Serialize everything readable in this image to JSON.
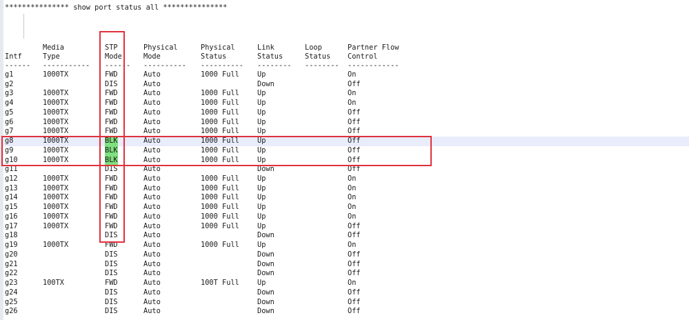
{
  "title_line": "*************** show port status all ***************",
  "columns": [
    {
      "key": "intf",
      "line1": "",
      "line2": "Intf",
      "dash": "------"
    },
    {
      "key": "media",
      "line1": "Media",
      "line2": "Type",
      "dash": "-----------"
    },
    {
      "key": "stp",
      "line1": "STP",
      "line2": "Mode",
      "dash": "------"
    },
    {
      "key": "phys_mode",
      "line1": "Physical",
      "line2": "Mode",
      "dash": "----------"
    },
    {
      "key": "phys_status",
      "line1": "Physical",
      "line2": "Status",
      "dash": "----------"
    },
    {
      "key": "link",
      "line1": "Link",
      "line2": "Status",
      "dash": "--------"
    },
    {
      "key": "loop",
      "line1": "Loop",
      "line2": "Status",
      "dash": "--------"
    },
    {
      "key": "flow",
      "line1": "Partner Flow",
      "line2": "Control",
      "dash": "------------"
    }
  ],
  "rows": [
    {
      "intf": "g1",
      "media": "1000TX",
      "stp": "FWD",
      "phys_mode": "Auto",
      "phys_status": "1000 Full",
      "link": "Up",
      "loop": "",
      "flow": "On"
    },
    {
      "intf": "g2",
      "media": "",
      "stp": "DIS",
      "phys_mode": "Auto",
      "phys_status": "",
      "link": "Down",
      "loop": "",
      "flow": "Off"
    },
    {
      "intf": "g3",
      "media": "1000TX",
      "stp": "FWD",
      "phys_mode": "Auto",
      "phys_status": "1000 Full",
      "link": "Up",
      "loop": "",
      "flow": "On"
    },
    {
      "intf": "g4",
      "media": "1000TX",
      "stp": "FWD",
      "phys_mode": "Auto",
      "phys_status": "1000 Full",
      "link": "Up",
      "loop": "",
      "flow": "On"
    },
    {
      "intf": "g5",
      "media": "1000TX",
      "stp": "FWD",
      "phys_mode": "Auto",
      "phys_status": "1000 Full",
      "link": "Up",
      "loop": "",
      "flow": "Off"
    },
    {
      "intf": "g6",
      "media": "1000TX",
      "stp": "FWD",
      "phys_mode": "Auto",
      "phys_status": "1000 Full",
      "link": "Up",
      "loop": "",
      "flow": "Off"
    },
    {
      "intf": "g7",
      "media": "1000TX",
      "stp": "FWD",
      "phys_mode": "Auto",
      "phys_status": "1000 Full",
      "link": "Up",
      "loop": "",
      "flow": "Off"
    },
    {
      "intf": "g8",
      "media": "1000TX",
      "stp": "BLK",
      "phys_mode": "Auto",
      "phys_status": "1000 Full",
      "link": "Up",
      "loop": "",
      "flow": "Off",
      "highlight": true
    },
    {
      "intf": "g9",
      "media": "1000TX",
      "stp": "BLK",
      "phys_mode": "Auto",
      "phys_status": "1000 Full",
      "link": "Up",
      "loop": "",
      "flow": "Off",
      "highlight": true
    },
    {
      "intf": "g10",
      "media": "1000TX",
      "stp": "BLK",
      "phys_mode": "Auto",
      "phys_status": "1000 Full",
      "link": "Up",
      "loop": "",
      "flow": "Off",
      "highlight": true
    },
    {
      "intf": "g11",
      "media": "",
      "stp": "DIS",
      "phys_mode": "Auto",
      "phys_status": "",
      "link": "Down",
      "loop": "",
      "flow": "Off"
    },
    {
      "intf": "g12",
      "media": "1000TX",
      "stp": "FWD",
      "phys_mode": "Auto",
      "phys_status": "1000 Full",
      "link": "Up",
      "loop": "",
      "flow": "On"
    },
    {
      "intf": "g13",
      "media": "1000TX",
      "stp": "FWD",
      "phys_mode": "Auto",
      "phys_status": "1000 Full",
      "link": "Up",
      "loop": "",
      "flow": "On"
    },
    {
      "intf": "g14",
      "media": "1000TX",
      "stp": "FWD",
      "phys_mode": "Auto",
      "phys_status": "1000 Full",
      "link": "Up",
      "loop": "",
      "flow": "On"
    },
    {
      "intf": "g15",
      "media": "1000TX",
      "stp": "FWD",
      "phys_mode": "Auto",
      "phys_status": "1000 Full",
      "link": "Up",
      "loop": "",
      "flow": "On"
    },
    {
      "intf": "g16",
      "media": "1000TX",
      "stp": "FWD",
      "phys_mode": "Auto",
      "phys_status": "1000 Full",
      "link": "Up",
      "loop": "",
      "flow": "On"
    },
    {
      "intf": "g17",
      "media": "1000TX",
      "stp": "FWD",
      "phys_mode": "Auto",
      "phys_status": "1000 Full",
      "link": "Up",
      "loop": "",
      "flow": "Off"
    },
    {
      "intf": "g18",
      "media": "",
      "stp": "DIS",
      "phys_mode": "Auto",
      "phys_status": "",
      "link": "Down",
      "loop": "",
      "flow": "Off"
    },
    {
      "intf": "g19",
      "media": "1000TX",
      "stp": "FWD",
      "phys_mode": "Auto",
      "phys_status": "1000 Full",
      "link": "Up",
      "loop": "",
      "flow": "On"
    },
    {
      "intf": "g20",
      "media": "",
      "stp": "DIS",
      "phys_mode": "Auto",
      "phys_status": "",
      "link": "Down",
      "loop": "",
      "flow": "Off"
    },
    {
      "intf": "g21",
      "media": "",
      "stp": "DIS",
      "phys_mode": "Auto",
      "phys_status": "",
      "link": "Down",
      "loop": "",
      "flow": "Off"
    },
    {
      "intf": "g22",
      "media": "",
      "stp": "DIS",
      "phys_mode": "Auto",
      "phys_status": "",
      "link": "Down",
      "loop": "",
      "flow": "Off"
    },
    {
      "intf": "g23",
      "media": "100TX",
      "stp": "FWD",
      "phys_mode": "Auto",
      "phys_status": "100T Full",
      "link": "Up",
      "loop": "",
      "flow": "On"
    },
    {
      "intf": "g24",
      "media": "",
      "stp": "DIS",
      "phys_mode": "Auto",
      "phys_status": "",
      "link": "Down",
      "loop": "",
      "flow": "Off"
    },
    {
      "intf": "g25",
      "media": "",
      "stp": "DIS",
      "phys_mode": "Auto",
      "phys_status": "",
      "link": "Down",
      "loop": "",
      "flow": "Off"
    },
    {
      "intf": "g26",
      "media": "",
      "stp": "DIS",
      "phys_mode": "Auto",
      "phys_status": "",
      "link": "Down",
      "loop": "",
      "flow": "Off"
    }
  ],
  "colors": {
    "highlight_row": "#e8ecfb",
    "blk_highlight": "#7fe07f",
    "annotation_red": "#e0303a"
  }
}
